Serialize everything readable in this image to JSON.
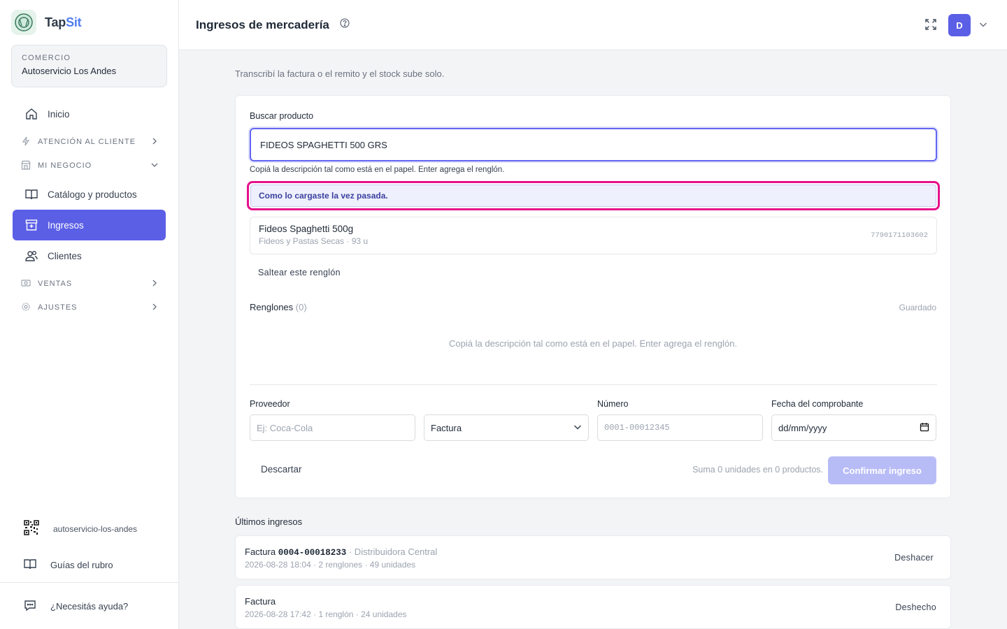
{
  "brand": {
    "name_part1": "Tap",
    "name_part2": "Sit"
  },
  "store": {
    "kicker": "COMERCIO",
    "name": "Autoservicio Los Andes"
  },
  "sidebar": {
    "inicio": "Inicio",
    "atencion": "ATENCIÓN AL CLIENTE",
    "mi_negocio": "MI NEGOCIO",
    "catalogo": "Catálogo y productos",
    "ingresos": "Ingresos",
    "clientes": "Clientes",
    "ventas": "VENTAS",
    "ajustes": "AJUSTES",
    "qr_slug": "autoservicio-los-andes",
    "guias": "Guías del rubro",
    "ayuda": "¿Necesitás ayuda?"
  },
  "topbar": {
    "title": "Ingresos de mercadería",
    "avatar_initial": "D"
  },
  "main": {
    "subtitle": "Transcribí la factura o el remito y el stock sube solo.",
    "search_label": "Buscar producto",
    "search_value": "FIDEOS SPAGHETTI 500 GRS",
    "hint": "Copiá la descripción tal como está en el papel. Enter agrega el renglón.",
    "suggest_label": "Como lo cargaste la vez pasada.",
    "product": {
      "name": "Fideos Spaghetti 500g",
      "meta": "Fideos y Pastas Secas · 93 u",
      "code": "7790171103602"
    },
    "skip": "Saltear este renglón",
    "rows_label": "Renglones",
    "rows_count": "(0)",
    "saved": "Guardado",
    "empty": "Copiá la descripción tal como está en el papel. Enter agrega el renglón.",
    "proveedor_label": "Proveedor",
    "proveedor_placeholder": "Ej: Coca-Cola",
    "tipo_value": "Factura",
    "numero_label": "Número",
    "numero_placeholder": "0001-00012345",
    "fecha_label": "Fecha del comprobante",
    "fecha_placeholder": "dd/mm/yyyy",
    "discard": "Descartar",
    "sum": "Suma 0 unidades en 0 productos.",
    "confirm": "Confirmar ingreso"
  },
  "recent": {
    "title": "Últimos ingresos",
    "items": [
      {
        "type": "Factura",
        "number": "0004-00018233",
        "provider": "· Distribuidora Central",
        "meta": "2026-08-28 18:04 · 2 renglones · 49 unidades",
        "action": "Deshacer"
      },
      {
        "type": "Factura",
        "number": "",
        "provider": "",
        "meta": "2026-08-28 17:42 · 1 renglón · 24 unidades",
        "action": "Deshecho"
      }
    ]
  },
  "colors": {
    "accent": "#5b5fe6",
    "highlight": "#e6118a",
    "brand_blue": "#4f7cf0"
  },
  "icons": [
    "home-icon",
    "bolt-icon",
    "store-icon",
    "book-icon",
    "inbox-icon",
    "users-icon",
    "cash-icon",
    "gear-icon",
    "qr-icon",
    "help-circle-icon",
    "expand-icon",
    "chevron-down-icon",
    "chat-icon"
  ]
}
